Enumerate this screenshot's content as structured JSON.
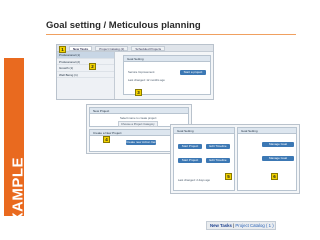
{
  "slide": {
    "title": "Goal setting / Meticulous planning",
    "side_label": "EXAMPLE",
    "accent_color": "#e96a1f"
  },
  "shot_top": {
    "tabs": [
      "New Tasks",
      "Project Catalog (2)",
      "Scheduled Projects"
    ],
    "nav": [
      "Professional (1)",
      "Professional (2)",
      "Growth (1)",
      "Well Being (1)"
    ],
    "markers": [
      "1",
      "2",
      "3"
    ],
    "panel_title": "Goal Setting",
    "section_label": "Service Improvement",
    "button": "Start a project",
    "note": "Last changed: 12 months ago"
  },
  "shot_mid": {
    "head1": "New Project",
    "text1": "Select name to create project",
    "select": "Choose a Project Category",
    "head2": "Create a New Project",
    "button": "Create new Action Item",
    "marker": "4"
  },
  "shot_right": {
    "head_left": "Goal Setting",
    "head_right": "Goal Setting",
    "buttons": [
      "Start Project",
      "Edit Timeline",
      "Start Project",
      "Edit Timeline"
    ],
    "right_btn": "Manage Goal",
    "markers": [
      "5",
      "6"
    ],
    "note": "Last changed: 2 days ago"
  },
  "breadcrumb": {
    "first": "New Tasks",
    "separator": " | ",
    "second": "Project Catalog ( 1 )"
  },
  "icons": [
    "marker-badge"
  ]
}
